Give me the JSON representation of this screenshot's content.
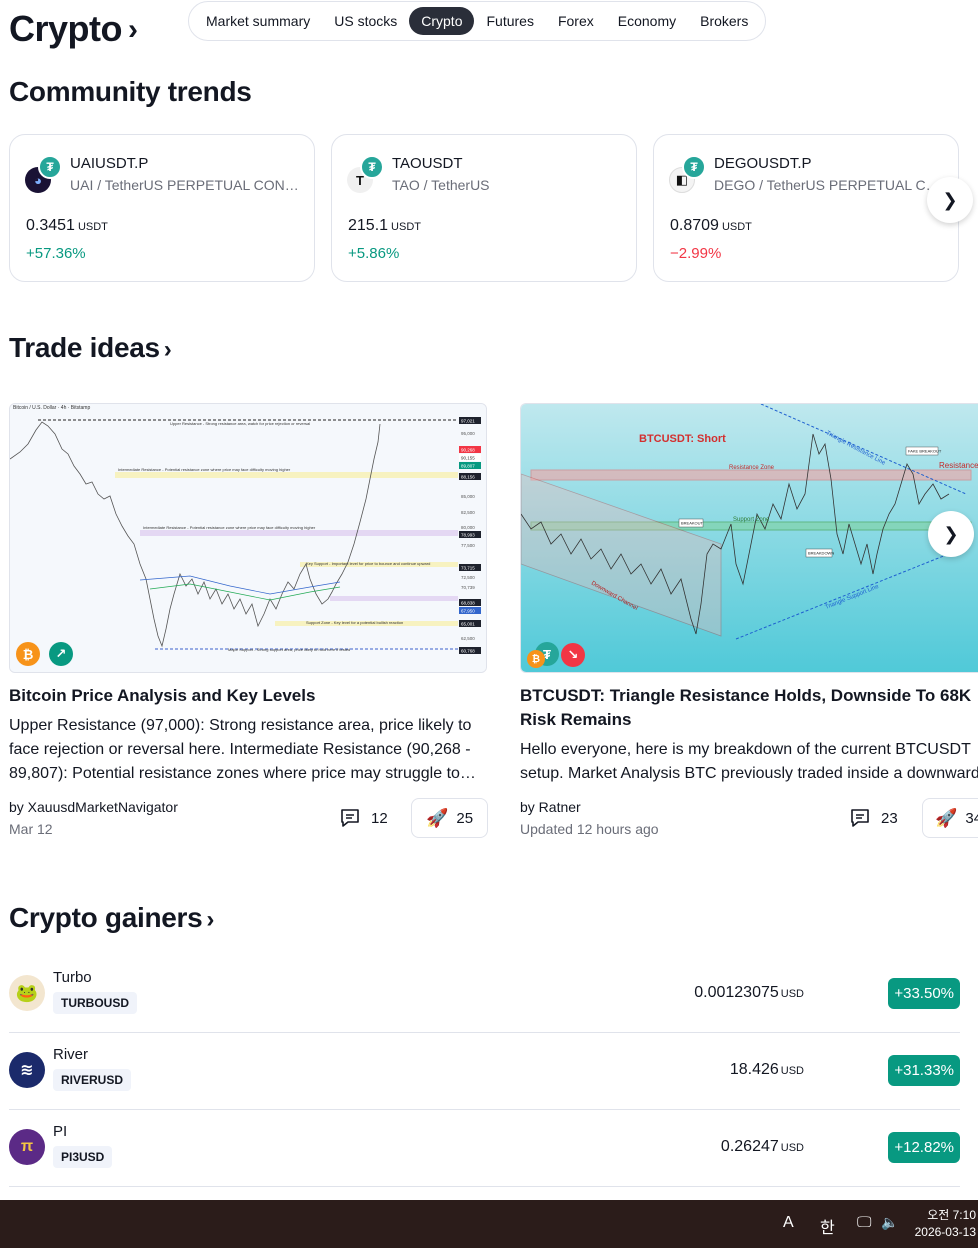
{
  "header": {
    "title": "Crypto",
    "tabs": [
      "Market summary",
      "US stocks",
      "Crypto",
      "Futures",
      "Forex",
      "Economy",
      "Brokers"
    ],
    "active_tab": "Crypto"
  },
  "community_trends": {
    "title": "Community trends",
    "cards": [
      {
        "symbol": "UAIUSDT.P",
        "description": "UAI / TetherUS PERPETUAL CONTRACT",
        "price": "0.3451",
        "unit": "USDT",
        "change": "+57.36%",
        "direction": "up",
        "logo_icon": "uai-logo-icon"
      },
      {
        "symbol": "TAOUSDT",
        "description": "TAO / TetherUS",
        "price": "215.1",
        "unit": "USDT",
        "change": "+5.86%",
        "direction": "up",
        "logo_icon": "tao-logo-icon"
      },
      {
        "symbol": "DEGOUSDT.P",
        "description": "DEGO / TetherUS PERPETUAL CONTRACT",
        "price": "0.8709",
        "unit": "USDT",
        "change": "−2.99%",
        "direction": "down",
        "logo_icon": "dego-logo-icon"
      }
    ]
  },
  "trade_ideas": {
    "title": "Trade ideas",
    "items": [
      {
        "title": "Bitcoin Price Analysis and Key Levels",
        "body": "Upper Resistance (97,000): Strong resistance area, price likely to face rejection or reversal here. Intermediate Resistance (90,268 - 89,807): Potential resistance zones where price may struggle to…",
        "author": "by XauusdMarketNavigator",
        "date": "Mar 12",
        "comments": "12",
        "boosts": "25",
        "direction": "long",
        "chart_header": "Bitcoin / U.S. Dollar · 4h · Bitstamp",
        "annotations": [
          "Upper Resistance - Strong resistance area, watch for price rejection or reversal",
          "Intermediate Resistance - Potential resistance zone where price may face difficulty moving higher",
          "Intermediate Resistance - Potential resistance zone where price may face difficulty moving higher",
          "Key Support - Important level for price to bounce and continue upward",
          "Support Zone - Key level for a potential bullish reaction",
          "Major Support - Strong support area, price likely to hold here if tested"
        ],
        "price_labels": [
          "97,021",
          "95,000",
          "90,268",
          "90,155",
          "89,807",
          "88,156",
          "85,000",
          "82,500",
          "80,000",
          "78,993",
          "77,500",
          "73,715",
          "72,500",
          "70,739",
          "68,838",
          "67,950",
          "65,001",
          "62,500",
          "60,768"
        ]
      },
      {
        "title": "BTCUSDT: Triangle Resistance Holds, Downside To 68K Risk Remains",
        "body": "Hello everyone, here is my breakdown of the current BTCUSDT setup. Market Analysis BTC previously traded inside a downward",
        "author": "by Ratner",
        "date": "Updated 12 hours ago",
        "comments": "23",
        "boosts": "34",
        "direction": "short",
        "chart_header": "BTCUSDT: Short",
        "annotations": [
          "Resistance Zone",
          "Resistance",
          "Support Zone",
          "Triangle Resistance Line",
          "Triangle Support Line",
          "Downward Channel",
          "BREAKOUT",
          "BREAKDOWN",
          "FAKE BREAKOUT"
        ]
      }
    ]
  },
  "gainers": {
    "title": "Crypto gainers",
    "rows": [
      {
        "name": "Turbo",
        "ticker": "TURBOUSD",
        "price": "0.00123075",
        "unit": "USD",
        "change": "+33.50%",
        "logo_icon": "turbo-logo-icon",
        "color": "#e8d6b8"
      },
      {
        "name": "River",
        "ticker": "RIVERUSD",
        "price": "18.426",
        "unit": "USD",
        "change": "+31.33%",
        "logo_icon": "river-logo-icon",
        "color": "#1b2a6b"
      },
      {
        "name": "PI",
        "ticker": "PI3USD",
        "price": "0.26247",
        "unit": "USD",
        "change": "+12.82%",
        "logo_icon": "pi-logo-icon",
        "color": "#5b2a86"
      }
    ]
  },
  "taskbar": {
    "ime_lang": "A",
    "ime_mode": "한",
    "time": "오전 7:10",
    "date": "2026-03-13"
  },
  "colors": {
    "positive": "#089981",
    "negative": "#f23645",
    "text": "#131722",
    "muted": "#6a6d78",
    "tab_active": "#2a2e39"
  }
}
